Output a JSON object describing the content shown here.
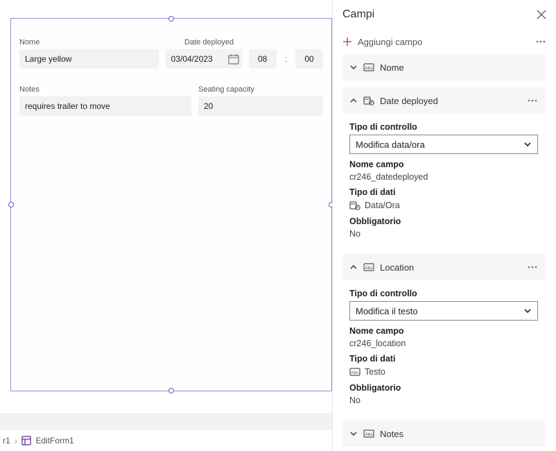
{
  "panel": {
    "title": "Campi",
    "add_field": "Aggiungi campo"
  },
  "form": {
    "labels": {
      "name": "Nome",
      "date_deployed": "Date deployed",
      "notes": "Notes",
      "seating": "Seating capacity"
    },
    "values": {
      "name": "Large yellow",
      "date": "03/04/2023",
      "hh": "08",
      "mm": "00",
      "notes": "requires trailer to move",
      "seating": "20"
    }
  },
  "crumbs": {
    "prev_suffix": "r1",
    "current": "EditForm1"
  },
  "props": {
    "control_type": "Tipo di controllo",
    "field_name": "Nome campo",
    "data_type": "Tipo di dati",
    "required": "Obbligatorio",
    "datetime": "Data/Ora",
    "text": "Testo",
    "no": "No"
  },
  "fields": [
    {
      "title": "Nome"
    },
    {
      "title": "Date deployed",
      "control_type": "Modifica data/ora",
      "field_name": "cr246_datedeployed",
      "data_type": "datetime",
      "required": "no"
    },
    {
      "title": "Location",
      "control_type": "Modifica il testo",
      "field_name": "cr246_location",
      "data_type": "text",
      "required": "no"
    },
    {
      "title": "Notes"
    }
  ]
}
